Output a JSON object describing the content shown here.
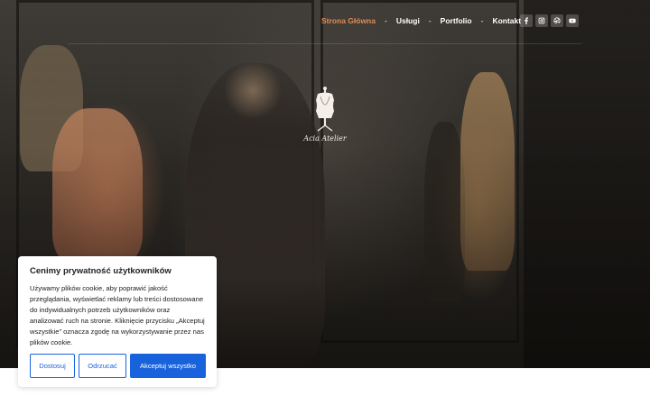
{
  "nav": {
    "items": [
      {
        "label": "Strona Główna",
        "active": true
      },
      {
        "label": "Usługi",
        "active": false
      },
      {
        "label": "Portfolio",
        "active": false
      },
      {
        "label": "Kontakt",
        "active": false
      }
    ],
    "separator": "-",
    "active_color": "#e08a5a"
  },
  "social": [
    {
      "icon": "facebook-icon"
    },
    {
      "icon": "instagram-icon"
    },
    {
      "icon": "dribbble-icon"
    },
    {
      "icon": "youtube-icon"
    }
  ],
  "logo": {
    "text": "Acia Atelier",
    "icon": "dress-form-icon"
  },
  "cookie": {
    "title": "Cenimy prywatność użytkowników",
    "text": "Używamy plików cookie, aby poprawić jakość przeglądania, wyświetlać reklamy lub treści dostosowane do indywidualnych potrzeb użytkowników oraz analizować ruch na stronie. Kliknięcie przycisku „Akceptuj wszystkie” oznacza zgodę na wykorzystywanie przez nas plików cookie.",
    "buttons": {
      "customize": "Dostosuj",
      "reject": "Odrzucać",
      "accept": "Akceptuj wszystko"
    },
    "accent_color": "#1863dc"
  }
}
